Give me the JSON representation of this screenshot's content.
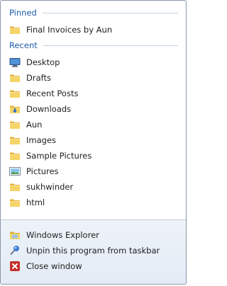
{
  "pinned": {
    "header": "Pinned",
    "items": [
      {
        "label": "Final Invoices by Aun"
      }
    ]
  },
  "recent": {
    "header": "Recent",
    "items": [
      {
        "label": "Desktop"
      },
      {
        "label": "Drafts"
      },
      {
        "label": "Recent Posts"
      },
      {
        "label": "Downloads"
      },
      {
        "label": "Aun"
      },
      {
        "label": "Images"
      },
      {
        "label": "Sample Pictures"
      },
      {
        "label": "Pictures"
      },
      {
        "label": "sukhwinder"
      },
      {
        "label": "html"
      }
    ]
  },
  "tasks": {
    "open_app": "Windows Explorer",
    "unpin": "Unpin this program from taskbar",
    "close": "Close window"
  },
  "colors": {
    "header_text": "#1f5aa8",
    "folder_yellow": "#f2cd5c",
    "close_red": "#c4302b"
  }
}
